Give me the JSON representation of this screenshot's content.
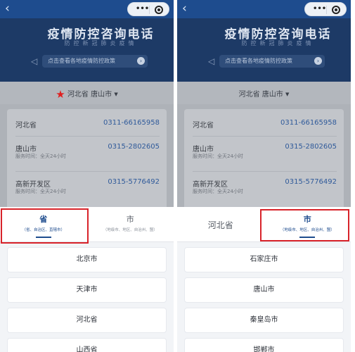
{
  "colors": {
    "brand": "#1e4c8e",
    "highlight": "#d8232a",
    "star": "#e01e1e"
  },
  "icons": {
    "back": "chevron-left-icon",
    "more": "more-dots-icon",
    "close": "target-circle-icon",
    "notice": "megaphone-icon",
    "arrow": "right-arrow-icon",
    "location": "star-icon",
    "dropdown": "caret-down-icon"
  },
  "header": {
    "title": "疫情防控咨询电话",
    "subtitle": "防控新冠肺炎疫情",
    "banner": "点击查看各地疫情防控政策"
  },
  "left": {
    "region": {
      "province": "河北省",
      "city": "唐山市"
    },
    "entries": [
      {
        "name": "河北省",
        "phone": "0311-66165958",
        "hours": ""
      },
      {
        "name": "唐山市",
        "phone": "0315-2802605",
        "hours": "服务时间：全天24小时"
      },
      {
        "name": "高新开发区",
        "phone": "0315-5776492",
        "hours": "服务时间：全天24小时"
      }
    ],
    "tabs": [
      {
        "label": "省",
        "hint": "（省、自治区、直辖市）",
        "active": true
      },
      {
        "label": "市",
        "hint": "（地级市、地区、自治州、盟）",
        "active": false
      }
    ],
    "options": [
      "北京市",
      "天津市",
      "河北省",
      "山西省"
    ]
  },
  "right": {
    "region": {
      "province": "河北省",
      "city": "唐山市"
    },
    "entries": [
      {
        "name": "河北省",
        "phone": "0311-66165958",
        "hours": ""
      },
      {
        "name": "唐山市",
        "phone": "0315-2802605",
        "hours": "服务时间：全天24小时"
      },
      {
        "name": "高新开发区",
        "phone": "0315-5776492",
        "hours": "服务时间：全天24小时"
      }
    ],
    "tabs": [
      {
        "label": "河北省",
        "hint": "",
        "active": false
      },
      {
        "label": "市",
        "hint": "（地级市、地区、自治州、盟）",
        "active": true
      }
    ],
    "options": [
      "石家庄市",
      "唐山市",
      "秦皇岛市",
      "邯郸市"
    ]
  }
}
